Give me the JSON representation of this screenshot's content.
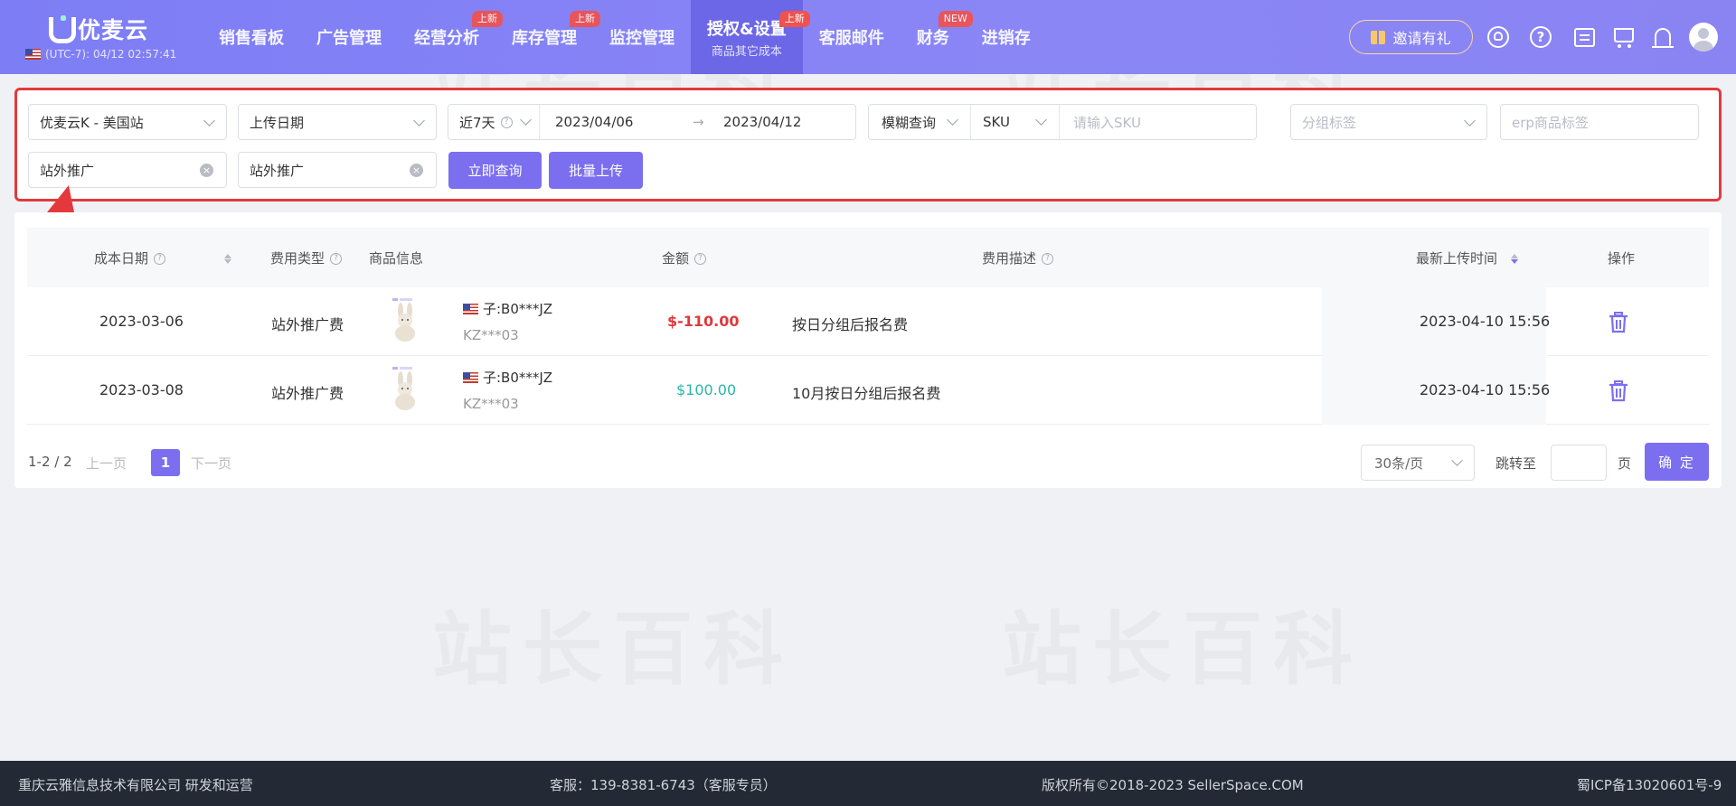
{
  "app": {
    "logo_text": "优麦云",
    "clock": "(UTC-7): 04/12 02:57:41"
  },
  "nav": {
    "items": [
      {
        "label": "销售看板",
        "badge": ""
      },
      {
        "label": "广告管理",
        "badge": ""
      },
      {
        "label": "经营分析",
        "badge": "上新"
      },
      {
        "label": "库存管理",
        "badge": "上新"
      },
      {
        "label": "监控管理",
        "badge": ""
      },
      {
        "label": "授权&设置",
        "badge": "上新",
        "sub": "商品其它成本",
        "active": true
      },
      {
        "label": "客服邮件",
        "badge": ""
      },
      {
        "label": "财务",
        "badge": "NEW"
      },
      {
        "label": "进销存",
        "badge": ""
      }
    ],
    "invite_label": "邀请有礼",
    "help_glyph": "?"
  },
  "filters": {
    "store": "优麦云K - 美国站",
    "date_type": "上传日期",
    "range_preset": "近7天",
    "date_start": "2023/04/06",
    "date_sep": "→",
    "date_end": "2023/04/12",
    "match_mode": "模糊查询",
    "search_field": "SKU",
    "sku_placeholder": "请输入SKU",
    "group_tag_placeholder": "分组标签",
    "erp_tag_placeholder": "erp商品标签",
    "cost_type_1": "站外推广",
    "cost_type_2": "站外推广",
    "query_button": "立即查询",
    "batch_upload_button": "批量上传"
  },
  "table": {
    "headers": {
      "cost_date": "成本日期",
      "fee_type": "费用类型",
      "product_info": "商品信息",
      "amount": "金额",
      "fee_desc": "费用描述",
      "upload_time": "最新上传时间",
      "actions": "操作"
    },
    "rows": [
      {
        "cost_date": "2023-03-06",
        "fee_type": "站外推广费",
        "asin": "子:B0***JZ",
        "sku": "KZ***03",
        "amount": "$-110.00",
        "amount_sign": "negative",
        "desc": "按日分组后报名费",
        "upload_time": "2023-04-10 15:56"
      },
      {
        "cost_date": "2023-03-08",
        "fee_type": "站外推广费",
        "asin": "子:B0***JZ",
        "sku": "KZ***03",
        "amount": "$100.00",
        "amount_sign": "positive",
        "desc": "10月按日分组后报名费",
        "upload_time": "2023-04-10 15:56"
      }
    ]
  },
  "pagination": {
    "summary": "1-2 / 2",
    "prev": "上一页",
    "current": "1",
    "next": "下一页",
    "page_size": "30条/页",
    "jump_label": "跳转至",
    "page_unit": "页",
    "confirm": "确 定"
  },
  "watermark": "站长百科",
  "footer": {
    "company": "重庆云雅信息技术有限公司 研发和运营",
    "service": "客服：139-8381-6743（客服专员）",
    "copyright": "版权所有©2018-2023 SellerSpace.COM",
    "icp": "蜀ICP备13020601号-9"
  },
  "colors": {
    "accent": "#7b6ff0",
    "nav_bg": "#8a84f3",
    "negative": "#e0393c",
    "positive": "#2ab7a9",
    "highlight_border": "#e4393c"
  },
  "icons": [
    "logo-icon",
    "us-flag-icon",
    "gift-icon",
    "headset-icon",
    "help-icon",
    "message-icon",
    "cart-icon",
    "bell-icon",
    "avatar",
    "trash-icon",
    "red-arrow"
  ]
}
